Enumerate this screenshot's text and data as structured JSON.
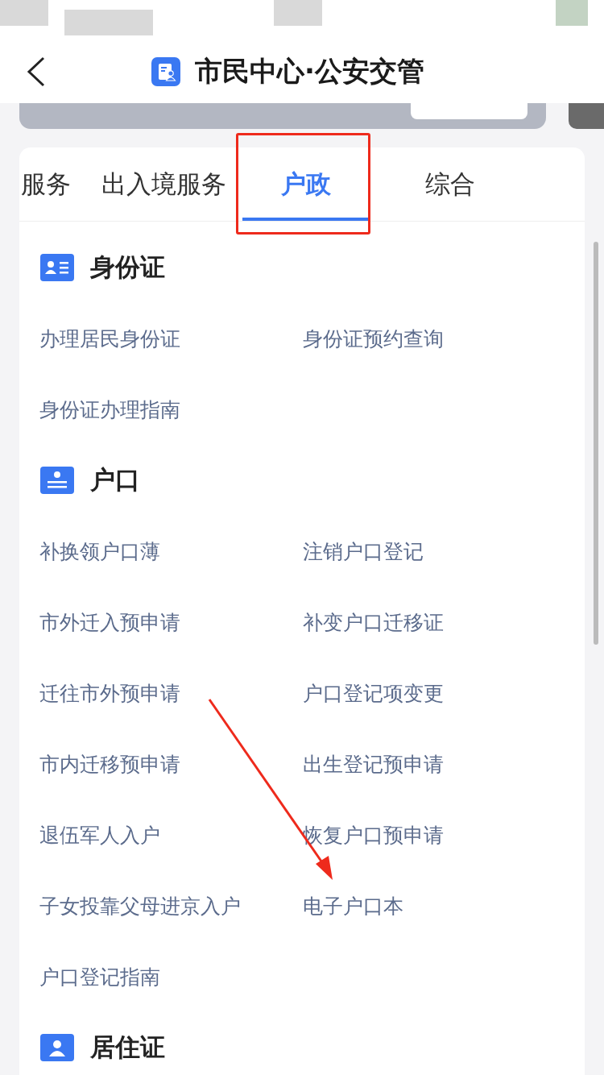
{
  "header": {
    "title": "市民中心·公安交管"
  },
  "tabs": [
    {
      "label": "服务",
      "selected": false
    },
    {
      "label": "出入境服务",
      "selected": false
    },
    {
      "label": "户政",
      "selected": true
    },
    {
      "label": "综合",
      "selected": false
    }
  ],
  "sections": [
    {
      "title": "身份证",
      "items": [
        "办理居民身份证",
        "身份证预约查询",
        "身份证办理指南"
      ]
    },
    {
      "title": "户口",
      "items": [
        "补换领户口薄",
        "注销户口登记",
        "市外迁入预申请",
        "补变户口迁移证",
        "迁往市外预申请",
        "户口登记项变更",
        "市内迁移预申请",
        "出生登记预申请",
        "退伍军人入户",
        "恢复户口预申请",
        "子女投靠父母进京入户",
        "电子户口本",
        "户口登记指南"
      ]
    },
    {
      "title": "居住证"
    }
  ]
}
